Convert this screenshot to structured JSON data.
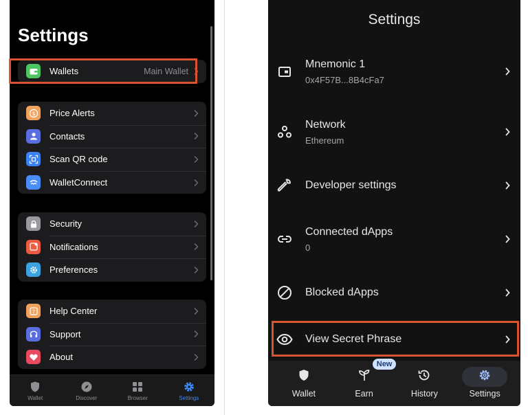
{
  "left": {
    "title": "Settings",
    "wallets_row": {
      "label": "Wallets",
      "value": "Main Wallet",
      "icon": "wallet-icon"
    },
    "group1": [
      {
        "label": "Price Alerts",
        "icon": "dollar-icon",
        "color": "#f0a35e"
      },
      {
        "label": "Contacts",
        "icon": "person-icon",
        "color": "#5b6ee0"
      },
      {
        "label": "Scan QR code",
        "icon": "qr-scan-icon",
        "color": "#3b82f6"
      },
      {
        "label": "WalletConnect",
        "icon": "walletconnect-icon",
        "color": "#4b8df8"
      }
    ],
    "group2": [
      {
        "label": "Security",
        "icon": "lock-icon",
        "color": "#9a9a9e"
      },
      {
        "label": "Notifications",
        "icon": "bell-icon",
        "color": "#ef5a43"
      },
      {
        "label": "Preferences",
        "icon": "gear-icon",
        "color": "#3aa3e0"
      }
    ],
    "group3": [
      {
        "label": "Help Center",
        "icon": "help-icon",
        "color": "#f0a35e"
      },
      {
        "label": "Support",
        "icon": "headphones-icon",
        "color": "#5b6ee0"
      },
      {
        "label": "About",
        "icon": "heart-icon",
        "color": "#e84a5f"
      }
    ],
    "tabs": [
      {
        "label": "Wallet",
        "icon": "shield-icon"
      },
      {
        "label": "Discover",
        "icon": "compass-icon"
      },
      {
        "label": "Browser",
        "icon": "grid-icon"
      },
      {
        "label": "Settings",
        "icon": "gear-icon",
        "active": true
      }
    ],
    "accent": "#3d8bfd"
  },
  "right": {
    "title": "Settings",
    "rows": [
      {
        "label": "Mnemonic 1",
        "sub": "0x4F57B...8B4cFa7",
        "icon": "wallet-icon"
      },
      {
        "label": "Network",
        "sub": "Ethereum",
        "icon": "network-icon"
      },
      {
        "label": "Developer settings",
        "icon": "wrench-icon"
      },
      {
        "label": "Connected dApps",
        "sub": "0",
        "icon": "link-icon"
      },
      {
        "label": "Blocked dApps",
        "icon": "blocked-icon"
      },
      {
        "label": "View Secret Phrase",
        "icon": "eye-icon"
      }
    ],
    "tabs": [
      {
        "label": "Wallet",
        "icon": "shield-icon"
      },
      {
        "label": "Earn",
        "icon": "sprout-icon",
        "badge": "New"
      },
      {
        "label": "History",
        "icon": "history-icon"
      },
      {
        "label": "Settings",
        "icon": "gear-icon",
        "active": true
      }
    ]
  },
  "highlight_color": "#d9532f"
}
